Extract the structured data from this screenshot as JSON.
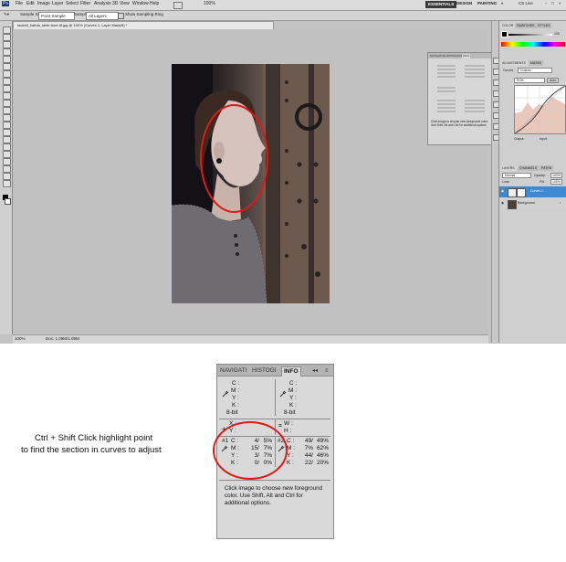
{
  "menubar": {
    "ps_logo": "Ps",
    "items": [
      "File",
      "Edit",
      "Image",
      "Layer",
      "Select",
      "Filter",
      "Analysis",
      "3D",
      "View",
      "Window",
      "Help"
    ],
    "zoom": "100%",
    "workspaces": [
      "ESSENTIALS",
      "DESIGN",
      "PAINTING"
    ],
    "cs_live": "CS Live"
  },
  "options": {
    "sample_size_label": "Sample Size:",
    "sample_size_value": "Point Sample",
    "sample_label": "Sample:",
    "sample_value": "All Layers",
    "show_ring": "Show Sampling Ring"
  },
  "document": {
    "tab_title": "tackett_kathia_table.tone.tif.jpg @ 100% (Curves 1, Layer Mask/8) *",
    "status_zoom": "100%",
    "status_doc": "Doc: 1.09M/1.09M"
  },
  "float_panel": {
    "tabs": [
      "NAVIGATOR",
      "HISTOGRAM",
      "INFO"
    ],
    "hint": "Click image to choose new foreground color. Use Shift, Alt and Ctrl for additional options."
  },
  "dock": {
    "color_tabs": [
      "COLOR",
      "SWATCHES",
      "STYLES"
    ],
    "color_value": "100",
    "adjust_tabs": [
      "ADJUSTMENTS",
      "MASKS"
    ],
    "curves_preset": "Custom",
    "channel": "RGB",
    "auto": "Auto",
    "output_label": "Output:",
    "input_label": "Input:",
    "layers_tabs": [
      "LAYERS",
      "CHANNELS",
      "PATHS"
    ],
    "blend_mode": "Normal",
    "opacity_label": "Opacity:",
    "opacity": "100%",
    "lock_label": "Lock:",
    "fill_label": "Fill:",
    "fill": "100%",
    "layers": [
      "Curves 1",
      "Background"
    ]
  },
  "info": {
    "tabs": [
      "NAVIGATI",
      "HISTOGI",
      "INFO"
    ],
    "top_left": {
      "labels": [
        "C :",
        "M :",
        "Y :",
        "K :"
      ],
      "bit": "8-bit"
    },
    "top_right": {
      "labels": [
        "C :",
        "M :",
        "Y :",
        "K :"
      ],
      "bit": "8-bit"
    },
    "x_label": "X :",
    "y_label": "Y :",
    "w_label": "W :",
    "h_label": "H :",
    "sample1": {
      "id": "#1",
      "labels": [
        "C :",
        "M :",
        "Y :",
        "K :"
      ],
      "v1": [
        "4/",
        "15/",
        "3/",
        "0/"
      ],
      "v2": [
        "5%",
        "7%",
        "7%",
        "0%"
      ]
    },
    "sample2": {
      "id": "#2",
      "labels": [
        "C :",
        "M :",
        "Y :",
        "K :"
      ],
      "v1": [
        "49/",
        "7%",
        "44/",
        "22/"
      ],
      "v2": [
        "49%",
        "62%",
        "46%",
        "20%"
      ]
    },
    "hint": "Click image to choose new foreground color.  Use Shift, Alt and Ctrl for additional options."
  },
  "caption": {
    "line1": "Ctrl + Shift Click highlight point",
    "line2": "to find the section in curves to adjust"
  },
  "colors": {
    "highlight": "#e31818",
    "panel": "#d9d9d9",
    "canvas": "#c1c1c1"
  }
}
